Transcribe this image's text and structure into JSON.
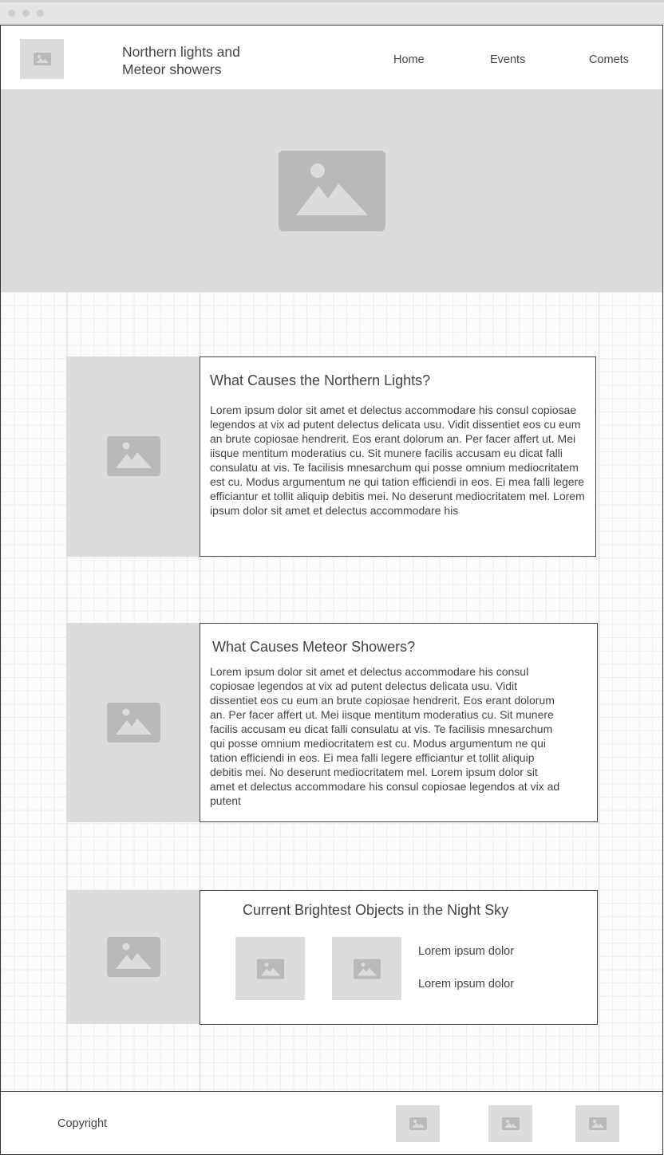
{
  "site": {
    "title": "Northern lights and Meteor showers",
    "logo_icon": "image-placeholder-icon"
  },
  "nav": {
    "items": [
      {
        "label": "Home"
      },
      {
        "label": "Events"
      },
      {
        "label": "Comets"
      }
    ]
  },
  "hero": {
    "icon": "image-placeholder-icon"
  },
  "sections": [
    {
      "heading": "What Causes the Northern Lights?",
      "body": "Lorem ipsum dolor sit amet et delectus accommodare his consul copiosae legendos at vix ad putent delectus delicata usu. Vidit dissentiet eos cu eum an brute copiosae hendrerit. Eos erant dolorum an. Per facer affert ut. Mei iisque mentitum moderatius cu. Sit munere facilis accusam eu dicat falli consulatu at vis. Te facilisis mnesarchum qui posse omnium mediocritatem est cu. Modus argumentum ne qui tation efficiendi in eos. Ei mea falli legere efficiantur et tollit aliquip debitis mei. No deserunt mediocritatem mel. Lorem ipsum dolor sit amet et delectus accommodare his"
    },
    {
      "heading": "What Causes Meteor Showers?",
      "body": "Lorem ipsum dolor sit amet et delectus accommodare his consul copiosae legendos at vix ad putent delectus delicata usu. Vidit dissentiet eos cu eum an brute copiosae hendrerit. Eos erant dolorum an. Per facer affert ut. Mei iisque mentitum moderatius cu. Sit munere facilis accusam eu dicat falli consulatu at vis. Te facilisis mnesarchum qui posse omnium mediocritatem est cu. Modus argumentum ne qui tation efficiendi in eos. Ei mea falli legere efficiantur et tollit aliquip debitis mei. No deserunt mediocritatem mel. Lorem ipsum dolor sit amet et delectus accommodare his consul copiosae legendos at vix ad putent"
    },
    {
      "heading": "Current Brightest Objects in the Night Sky",
      "items": [
        {
          "label": "Lorem ipsum dolor"
        },
        {
          "label": "Lorem ipsum dolor"
        }
      ]
    }
  ],
  "footer": {
    "copyright": "Copyright",
    "icons": [
      "image-placeholder-icon",
      "image-placeholder-icon",
      "image-placeholder-icon"
    ]
  },
  "colors": {
    "placeholder_bg": "#dcdcdc",
    "placeholder_icon": "#b9b9b9",
    "text": "#444444",
    "border": "#333333"
  }
}
